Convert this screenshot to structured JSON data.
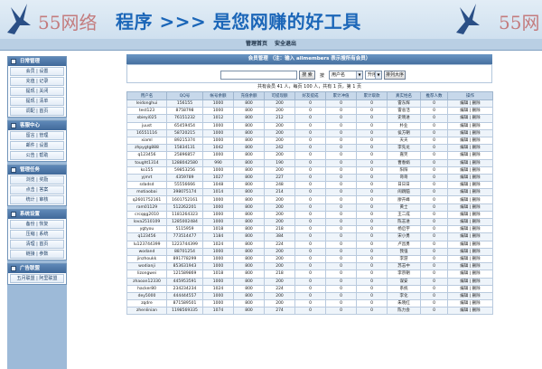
{
  "banner": {
    "ghost_left": "55网络",
    "slogan": "程序 >>> 是您网赚的好工具",
    "ghost_right": "55网"
  },
  "topnav": {
    "home": "管理首页",
    "logout": "安全退出"
  },
  "sidebar": [
    {
      "title": "日常管理",
      "items": [
        "会员 | 设置",
        "充值 | 记录",
        "提现 | 关闭",
        "提现 | 清单",
        "调配 | 首页"
      ]
    },
    {
      "title": "客服中心",
      "items": [
        "留言 | 管理",
        "邮件 | 设置",
        "公告 | 帮助"
      ]
    },
    {
      "title": "管理任务",
      "items": [
        "浏览 | 奖励",
        "点击 | 答案",
        "统计 | 审核"
      ]
    },
    {
      "title": "系统设置",
      "items": [
        "备份 | 恢复",
        "压缩 | 系统",
        "清理 | 首页",
        "链接 | 参数"
      ]
    },
    {
      "title": "广告联盟",
      "items": [
        "五月联盟 | 阿里联盟"
      ]
    }
  ],
  "main": {
    "title": "会员管理 （注：输入 allmembers 表示搜所有会员）",
    "search_placeholder": "",
    "search_button": "搜 索",
    "by_label": "按",
    "field_select": "用户名",
    "order_select": "升序",
    "sort_button": "排列大序",
    "stats": "共有会员 41 人，每页 100 人，共有 1 页，第 1 页"
  },
  "table": {
    "headers": [
      "用户名",
      "QQ号",
      "帐号余额",
      "充值余额",
      "可提现额",
      "好友提成",
      "累计冲值",
      "累计取款",
      "真实姓名",
      "推荐人数",
      "操作"
    ],
    "rows": [
      [
        "leidonghui",
        "156155",
        "1000",
        "800",
        "200",
        "0",
        "0",
        "0",
        "雷东辉",
        "0",
        "编辑 | 删除"
      ],
      [
        "test123",
        "8758798",
        "1000",
        "800",
        "200",
        "0",
        "0",
        "0",
        "雷总活",
        "0",
        "编辑 | 删除"
      ],
      [
        "xbieyi025",
        "76151232",
        "1012",
        "800",
        "212",
        "0",
        "0",
        "0",
        "史晓进",
        "0",
        "编辑 | 删除"
      ],
      [
        "juust",
        "65459454",
        "1000",
        "800",
        "200",
        "0",
        "0",
        "0",
        "朴业",
        "0",
        "编辑 | 删除"
      ],
      [
        "16551116",
        "58720215",
        "1000",
        "800",
        "200",
        "0",
        "0",
        "0",
        "侯方朝",
        "0",
        "编辑 | 删除"
      ],
      [
        "xiaml",
        "89215374",
        "1000",
        "800",
        "200",
        "0",
        "0",
        "0",
        "天天",
        "0",
        "编辑 | 删除"
      ],
      [
        "zhpygtg888",
        "15834131",
        "1042",
        "800",
        "242",
        "0",
        "0",
        "0",
        "李先龙",
        "0",
        "编辑 | 删除"
      ],
      [
        "q123456",
        "25896857",
        "1000",
        "800",
        "200",
        "0",
        "0",
        "0",
        "嘉笑",
        "0",
        "编辑 | 删除"
      ],
      [
        "tought1314",
        "1288042580",
        "990",
        "800",
        "190",
        "0",
        "0",
        "0",
        "曹春娟",
        "0",
        "编辑 | 删除"
      ],
      [
        "ko155",
        "59853256",
        "1000",
        "800",
        "200",
        "0",
        "0",
        "0",
        "阳阳",
        "0",
        "编辑 | 删除"
      ],
      [
        "yjmrt",
        "4359789",
        "1027",
        "800",
        "227",
        "0",
        "0",
        "0",
        "哥哥",
        "0",
        "编辑 | 删除"
      ],
      [
        "sdadsd",
        "55556666",
        "1048",
        "800",
        "248",
        "0",
        "0",
        "0",
        "日日日",
        "0",
        "编辑 | 删除"
      ],
      [
        "motiaobai",
        "398075174",
        "1014",
        "800",
        "214",
        "0",
        "0",
        "0",
        "闹跳脑",
        "0",
        "编辑 | 删除"
      ],
      [
        "q2601752161",
        "1601752161",
        "1000",
        "800",
        "200",
        "0",
        "0",
        "0",
        "廖卉峰",
        "0",
        "编辑 | 删除"
      ],
      [
        "ram01129",
        "512262201",
        "1000",
        "800",
        "200",
        "0",
        "0",
        "0",
        "黄士",
        "0",
        "编辑 | 删除"
      ],
      [
        "crcqqg2010",
        "1181264323",
        "1000",
        "800",
        "200",
        "0",
        "0",
        "0",
        "王二成",
        "0",
        "编辑 | 删除"
      ],
      [
        "lova2510109",
        "1285002484",
        "1000",
        "800",
        "200",
        "0",
        "0",
        "0",
        "陈志进",
        "0",
        "编辑 | 删除"
      ],
      [
        "ygtyou",
        "5115959",
        "1018",
        "800",
        "218",
        "0",
        "0",
        "0",
        "杨启宇",
        "0",
        "编辑 | 删除"
      ],
      [
        "q123456",
        "773514477",
        "1184",
        "800",
        "384",
        "0",
        "0",
        "0",
        "宋小勇",
        "0",
        "编辑 | 删除"
      ],
      [
        "lu123744399",
        "1223744399",
        "1024",
        "800",
        "224",
        "0",
        "0",
        "0",
        "卢昌勇",
        "0",
        "编辑 | 删除"
      ],
      [
        "wodand",
        "88701254",
        "1000",
        "800",
        "200",
        "0",
        "0",
        "0",
        "我强",
        "0",
        "编辑 | 删除"
      ],
      [
        "jinzhoukk",
        "891778299",
        "1000",
        "800",
        "200",
        "0",
        "0",
        "0",
        "李游",
        "0",
        "编辑 | 删除"
      ],
      [
        "wodianji",
        "853631943",
        "1000",
        "800",
        "200",
        "0",
        "0",
        "0",
        "苏志中",
        "0",
        "编辑 | 删除"
      ],
      [
        "lizongwei",
        "121589869",
        "1018",
        "800",
        "218",
        "0",
        "0",
        "0",
        "李宗朝",
        "0",
        "编辑 | 删除"
      ],
      [
        "zhaoan12330",
        "445953591",
        "1000",
        "800",
        "200",
        "0",
        "0",
        "0",
        "谋安",
        "0",
        "编辑 | 删除"
      ],
      [
        "hacker80",
        "234234234",
        "1024",
        "800",
        "224",
        "0",
        "0",
        "0",
        "系统",
        "0",
        "编辑 | 删除"
      ],
      [
        "dey5000",
        "444444557",
        "1000",
        "800",
        "200",
        "0",
        "0",
        "0",
        "李化",
        "0",
        "编辑 | 删除"
      ],
      [
        "zqdre",
        "871589501",
        "1000",
        "800",
        "200",
        "0",
        "0",
        "0",
        "朱晓红",
        "0",
        "编辑 | 删除"
      ],
      [
        "zhenlinian",
        "1198569335",
        "1074",
        "800",
        "274",
        "0",
        "0",
        "0",
        "陈力会",
        "0",
        "编辑 | 删除"
      ]
    ]
  }
}
